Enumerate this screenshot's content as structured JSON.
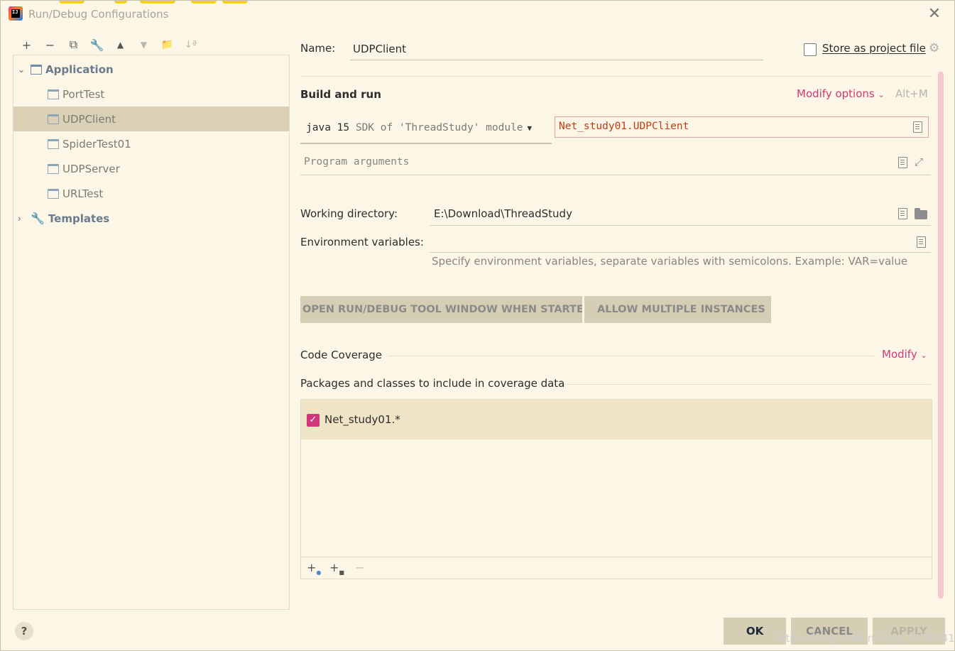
{
  "window": {
    "title": "Run/Debug Configurations",
    "app_icon_text": "IJ",
    "close_glyph": "✕"
  },
  "toolbar": {
    "add": "+",
    "remove": "−",
    "copy": "⧉",
    "edit": "🔧",
    "up": "▲",
    "down": "▼",
    "new_folder": "📁",
    "sort": "↓ª"
  },
  "tree": {
    "group_label": "Application",
    "items": [
      "PortTest",
      "UDPClient",
      "SpiderTest01",
      "UDPServer",
      "URLTest"
    ],
    "selected": "UDPClient",
    "templates_label": "Templates"
  },
  "config": {
    "name_label": "Name:",
    "name_value": "UDPClient",
    "store_label": "Store as project file",
    "store_checked": false,
    "build_run_title": "Build and run",
    "modify_options": "Modify options",
    "modify_shortcut": "Alt+M",
    "jre_strong": "java 15",
    "jre_rest": " SDK of 'ThreadStudy' module",
    "main_class": "Net_study01.UDPClient",
    "program_args_placeholder": "Program arguments",
    "workdir_label": "Working directory:",
    "workdir_value": "E:\\Download\\ThreadStudy",
    "env_label": "Environment variables:",
    "env_hint": "Specify environment variables, separate variables with semicolons. Example: VAR=value",
    "chips": [
      "OPEN RUN/DEBUG TOOL WINDOW WHEN STARTED",
      "ALLOW MULTIPLE INSTANCES"
    ],
    "coverage_title": "Code Coverage",
    "coverage_modify": "Modify",
    "packages_title": "Packages and classes to include in coverage data",
    "coverage_entries": [
      {
        "label": "Net_study01.*",
        "checked": true
      }
    ]
  },
  "footer": {
    "help": "?",
    "ok": "OK",
    "cancel": "CANCEL",
    "apply": "APPLY",
    "watermark": "https://blog.csdn.net/qq_51788416"
  },
  "colors": {
    "background": "#fbf6e6",
    "accent": "#cc3a76",
    "selection": "#d9d0b6"
  }
}
